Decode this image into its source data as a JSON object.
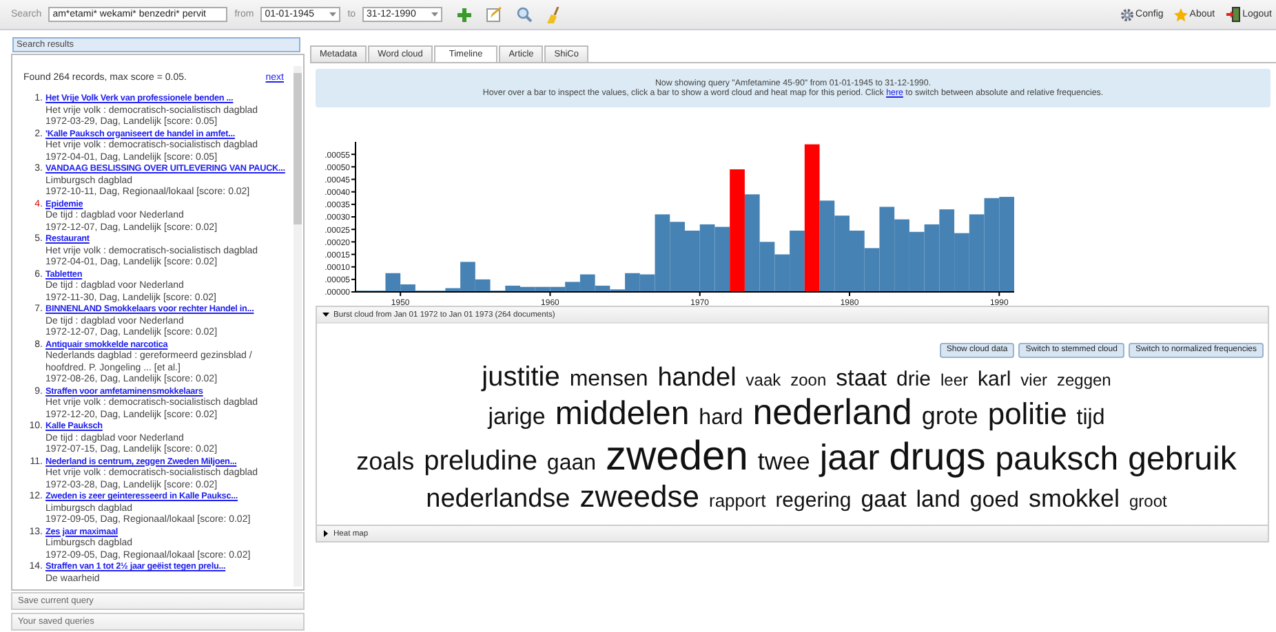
{
  "toolbar": {
    "search_label": "Search",
    "search_value": "am*etami* wekami* benzedri* pervit",
    "from_label": "from",
    "from_date": "01-01-1945",
    "to_label": "to",
    "to_date": "31-12-1990"
  },
  "menu": [
    {
      "label": "Config",
      "kind": "config"
    },
    {
      "label": "About",
      "kind": "about"
    },
    {
      "label": "Logout",
      "kind": "logout"
    }
  ],
  "sidebar": {
    "title": "Search results",
    "summary": "Found 264 records, max score = 0.05.",
    "next": "next",
    "results": [
      {
        "number": "1.",
        "title": "Het Vrije Volk Verk van professionele benden ...",
        "source": "Het vrije volk : democratisch-socialistisch dagblad",
        "date": "1972-03-29, Dag, Landelijk [score: 0.05]",
        "highlighted": false
      },
      {
        "number": "2.",
        "title": "'Kalle Pauksch organiseert de handel in amfet...",
        "source": "Het vrije volk : democratisch-socialistisch dagblad",
        "date": "1972-04-01, Dag, Landelijk [score: 0.05]",
        "highlighted": false
      },
      {
        "number": "3.",
        "title": "VANDAAG BESLISSING OVER UITLEVERING VAN PAUCK...",
        "source": "Limburgsch dagblad",
        "date": "1972-10-11, Dag, Regionaal/lokaal [score: 0.02]",
        "highlighted": false
      },
      {
        "number": "4.",
        "title": "Epidemie",
        "source": "De tijd : dagblad voor Nederland",
        "date": "1972-12-07, Dag, Landelijk [score: 0.02]",
        "highlighted": true
      },
      {
        "number": "5.",
        "title": "Restaurant",
        "source": "Het vrije volk : democratisch-socialistisch dagblad",
        "date": "1972-04-01, Dag, Landelijk [score: 0.02]",
        "highlighted": false
      },
      {
        "number": "6.",
        "title": "Tabletten",
        "source": "De tijd : dagblad voor Nederland",
        "date": "1972-11-30, Dag, Landelijk [score: 0.02]",
        "highlighted": false
      },
      {
        "number": "7.",
        "title": "BINNENLAND Smokkelaars voor rechter Handel in...",
        "source": "De tijd : dagblad voor Nederland",
        "date": "1972-12-07, Dag, Landelijk [score: 0.02]",
        "highlighted": false
      },
      {
        "number": "8.",
        "title": "Antiquair smokkelde narcotica",
        "source": "Nederlands dagblad : gereformeerd gezinsblad / hoofdred. P. Jongeling ... [et al.]",
        "date": "1972-08-26, Dag, Landelijk [score: 0.02]",
        "highlighted": false
      },
      {
        "number": "9.",
        "title": "Straffen voor amfetaminensmokkelaars",
        "source": "Het vrije volk : democratisch-socialistisch dagblad",
        "date": "1972-12-20, Dag, Landelijk [score: 0.02]",
        "highlighted": false
      },
      {
        "number": "10.",
        "title": "Kalle Pauksch",
        "source": "De tijd : dagblad voor Nederland",
        "date": "1972-07-15, Dag, Landelijk [score: 0.02]",
        "highlighted": false
      },
      {
        "number": "11.",
        "title": "Nederland is centrum, zeggen Zweden Miljoen...",
        "source": "Het vrije volk : democratisch-socialistisch dagblad",
        "date": "1972-03-28, Dag, Landelijk [score: 0.02]",
        "highlighted": false
      },
      {
        "number": "12.",
        "title": "Zweden is zeer geinteresseerd in Kalle Pauksc...",
        "source": "Limburgsch dagblad",
        "date": "1972-09-05, Dag, Regionaal/lokaal [score: 0.02]",
        "highlighted": false
      },
      {
        "number": "13.",
        "title": "Zes jaar maximaal",
        "source": "Limburgsch dagblad",
        "date": "1972-09-05, Dag, Regionaal/lokaal [score: 0.02]",
        "highlighted": false
      },
      {
        "number": "14.",
        "title": "Straffen van 1 tot 2½ jaar geëist tegen prelu...",
        "source": "De waarheid",
        "highlighted": false
      }
    ],
    "footer": [
      "Save current query",
      "Your saved queries"
    ]
  },
  "tabs": [
    {
      "label": "Metadata",
      "selected": false
    },
    {
      "label": "Word cloud",
      "selected": false
    },
    {
      "label": "Timeline",
      "selected": true
    },
    {
      "label": "Article",
      "selected": false
    },
    {
      "label": "ShiCo",
      "selected": false
    }
  ],
  "info": {
    "line1": "Now showing query \"Amfetamine 45-90\" from 01-01-1945 to 31-12-1990.",
    "before_link": "Hover over a bar to inspect the values, click a bar to show a word cloud and heat map for this period. Click ",
    "link": "here",
    "after_link": " to switch between absolute and relative frequencies."
  },
  "chart_data": {
    "type": "bar",
    "xlim": [
      1947,
      1991
    ],
    "ylim": [
      0,
      0.0006
    ],
    "xticks": [
      1950,
      1960,
      1970,
      1980,
      1990
    ],
    "yticks": [
      {
        "value": 0,
        "label": ".00000"
      },
      {
        "value": 5e-05,
        "label": ".00005"
      },
      {
        "value": 0.0001,
        "label": ".00010"
      },
      {
        "value": 0.00015,
        "label": ".00015"
      },
      {
        "value": 0.0002,
        "label": ".00020"
      },
      {
        "value": 0.00025,
        "label": ".00025"
      },
      {
        "value": 0.0003,
        "label": ".00030"
      },
      {
        "value": 0.00035,
        "label": ".00035"
      },
      {
        "value": 0.0004,
        "label": ".00040"
      },
      {
        "value": 0.00045,
        "label": ".00045"
      },
      {
        "value": 0.0005,
        "label": ".00050"
      },
      {
        "value": 0.00055,
        "label": ".00055"
      }
    ],
    "x": [
      1947,
      1948,
      1949,
      1950,
      1951,
      1952,
      1953,
      1954,
      1955,
      1956,
      1957,
      1958,
      1959,
      1960,
      1961,
      1962,
      1963,
      1964,
      1965,
      1966,
      1967,
      1968,
      1969,
      1970,
      1971,
      1972,
      1973,
      1974,
      1975,
      1976,
      1977,
      1978,
      1979,
      1980,
      1981,
      1982,
      1983,
      1984,
      1985,
      1986,
      1987,
      1988,
      1989,
      1990
    ],
    "series": [
      {
        "color": "#4682b4",
        "values": [
          5e-06,
          5e-06,
          7.5e-05,
          3e-05,
          5e-06,
          5e-06,
          1.5e-05,
          0.00012,
          5e-05,
          5e-06,
          2.5e-05,
          2e-05,
          2e-05,
          2e-05,
          4e-05,
          7e-05,
          2.5e-05,
          1e-05,
          7.5e-05,
          7e-05,
          0.00031,
          0.00028,
          0.000245,
          0.00027,
          0.00026,
          null,
          0.00039,
          0.0002,
          0.00015,
          0.000245,
          null,
          0.000365,
          0.000305,
          0.000245,
          0.000175,
          0.00034,
          0.00029,
          0.00024,
          0.00027,
          0.00033,
          0.000235,
          0.00031,
          0.000375,
          0.00038
        ]
      },
      {
        "color": "#ff0000",
        "values": [
          null,
          null,
          null,
          null,
          null,
          null,
          null,
          null,
          null,
          null,
          null,
          null,
          null,
          null,
          null,
          null,
          null,
          null,
          null,
          null,
          null,
          null,
          null,
          null,
          null,
          0.00049,
          null,
          null,
          null,
          null,
          0.00059,
          null,
          null,
          null,
          null,
          null,
          null,
          null,
          null,
          null,
          null,
          null,
          null,
          null
        ]
      }
    ]
  },
  "burst_cloud": {
    "title": "Burst cloud from Jan 01 1972 to Jan 01 1973 (264 documents)",
    "expanded": true,
    "buttons": [
      "Show cloud data",
      "Switch to stemmed cloud",
      "Switch to normalized frequencies"
    ],
    "words": [
      "justitie",
      "mensen",
      "handel",
      "vaak",
      "zoon",
      "staat",
      "drie",
      "leer",
      "karl",
      "vier",
      "zeggen",
      "jarige",
      "middelen",
      "hard",
      "nederland",
      "grote",
      "politie",
      "tijd",
      "zoals",
      "preludine",
      "gaan",
      "zweden",
      "twee",
      "jaar",
      "drugs",
      "pauksch",
      "gebruik",
      "nederlandse",
      "zweedse",
      "rapport",
      "regering",
      "gaat",
      "land",
      "goed",
      "smokkel",
      "groot"
    ]
  },
  "heat_map": {
    "title": "Heat map",
    "expanded": false
  }
}
